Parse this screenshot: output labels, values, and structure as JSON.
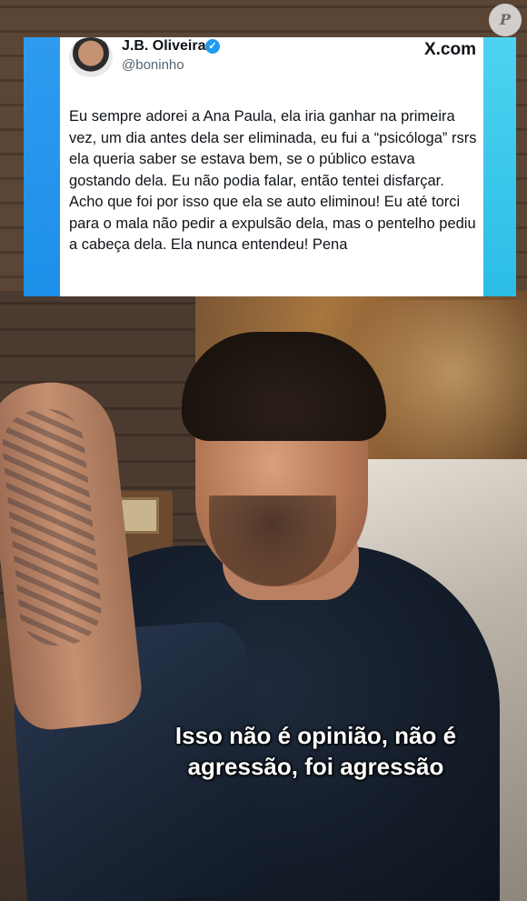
{
  "tweet": {
    "display_name": "J.B. Oliveira",
    "verified": "✓",
    "handle": "@boninho",
    "brand": "X.com",
    "text": "Eu sempre adorei a Ana Paula, ela iria ganhar na primeira vez, um dia antes dela ser eliminada, eu fui a “psicóloga” rsrs ela queria saber se estava bem, se o público estava gostando dela. Eu não podia falar, então tentei disfarçar. Acho que foi por isso que ela se auto eliminou! Eu até torci para o mala não pedir a expulsão dela, mas o pentelho pediu a cabeça dela. Ela nunca entendeu! Pena"
  },
  "watermark": {
    "letter": "P"
  },
  "subtitle": {
    "line1": "Isso não é opinião, não é",
    "line2": "agressão, foi agressão"
  },
  "colors": {
    "accent_left": "#1d8fe8",
    "accent_right": "#2bbde6",
    "verified": "#1d9bf0"
  }
}
